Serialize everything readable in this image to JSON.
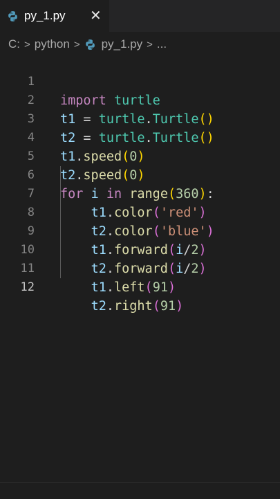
{
  "tab": {
    "title": "py_1.py",
    "close_glyph": "✕",
    "icon": "python-file-icon"
  },
  "breadcrumb": {
    "drive": "C:",
    "folder": "python",
    "file": "py_1.py",
    "more": "..."
  },
  "editor": {
    "active_line": 12,
    "lines": [
      {
        "n": "1"
      },
      {
        "n": "2"
      },
      {
        "n": "3"
      },
      {
        "n": "4"
      },
      {
        "n": "5"
      },
      {
        "n": "6"
      },
      {
        "n": "7"
      },
      {
        "n": "8"
      },
      {
        "n": "9"
      },
      {
        "n": "10"
      },
      {
        "n": "11"
      },
      {
        "n": "12"
      }
    ],
    "code": [
      "import turtle",
      "t1 = turtle.Turtle()",
      "t2 = turtle.Turtle()",
      "t1.speed(0)",
      "t2.speed(0)",
      "for i in range(360):",
      "    t1.color('red')",
      "    t2.color('blue')",
      "    t1.forward(i/2)",
      "    t2.forward(i/2)",
      "    t1.left(91)",
      "    t2.right(91)"
    ]
  },
  "colors": {
    "background": "#1e1e1e",
    "keyword": "#c586c0",
    "variable": "#9cdcfe",
    "class": "#4ec9b0",
    "function": "#dcdcaa",
    "number": "#b5cea8",
    "string": "#ce9178"
  }
}
